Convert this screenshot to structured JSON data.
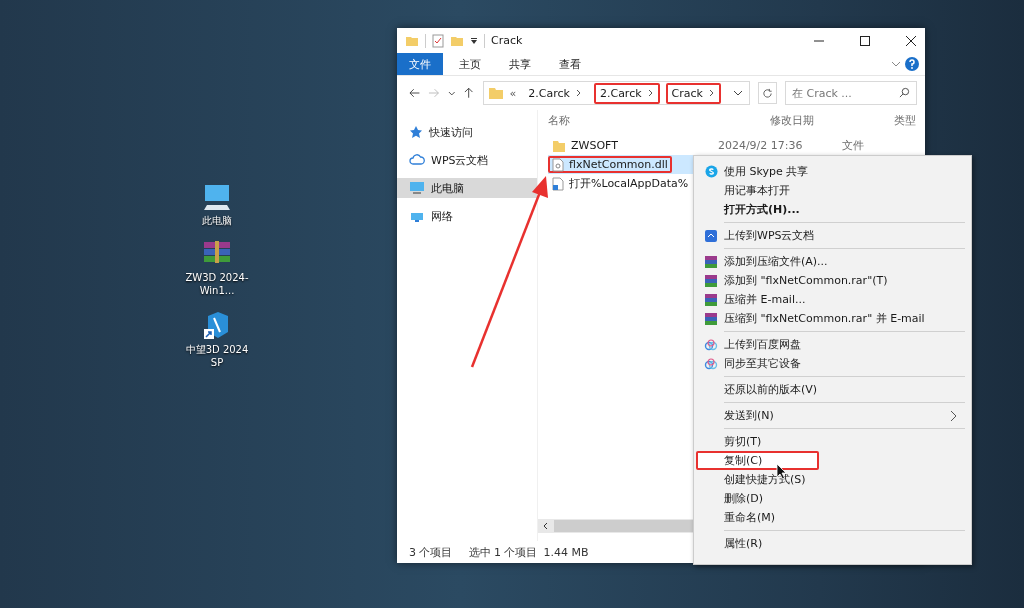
{
  "desktop_icons": [
    {
      "label": "此电脑",
      "kind": "computer"
    },
    {
      "label": "ZW3D 2024-Win1...",
      "kind": "archive"
    },
    {
      "label": "中望3D 2024 SP",
      "kind": "app"
    }
  ],
  "explorer": {
    "title": "Crack",
    "ribbon_tabs": [
      {
        "label": "文件",
        "selected": true
      },
      {
        "label": "主页",
        "selected": false
      },
      {
        "label": "共享",
        "selected": false
      },
      {
        "label": "查看",
        "selected": false
      }
    ],
    "address": {
      "overflow": "«",
      "crumbs": [
        {
          "label": "2.Carck",
          "highlighted": false
        },
        {
          "label": "2.Carck",
          "highlighted": true
        },
        {
          "label": "Crack",
          "highlighted": true
        }
      ]
    },
    "search": {
      "placeholder": "在 Crack ..."
    },
    "nav": [
      {
        "label": "快速访问",
        "kind": "star",
        "selected": false
      },
      {
        "label": "WPS云文档",
        "kind": "cloud",
        "selected": false
      },
      {
        "label": "此电脑",
        "kind": "computer",
        "selected": true
      },
      {
        "label": "网络",
        "kind": "network",
        "selected": false
      }
    ],
    "columns": [
      "名称",
      "修改日期",
      "类型"
    ],
    "rows": [
      {
        "name": "ZWSOFT",
        "date": "2024/9/2 17:36",
        "type": "文件",
        "kind": "folder",
        "selected": false,
        "highlighted": false
      },
      {
        "name": "flxNetCommon.dll",
        "kind": "file",
        "selected": true,
        "highlighted": true
      },
      {
        "name": "打开%LocalAppData%",
        "kind": "shortcut",
        "selected": false,
        "highlighted": false
      }
    ],
    "status": [
      "3 个项目",
      "选中 1 个项目",
      "1.44 MB"
    ]
  },
  "context_menu": {
    "groups": [
      [
        {
          "label": "使用 Skype 共享",
          "kind": "skype",
          "bold": false,
          "selected": false,
          "highlighted": false,
          "submenu": false
        },
        {
          "label": "用记事本打开",
          "bold": false,
          "selected": false,
          "highlighted": false,
          "submenu": false
        },
        {
          "label": "打开方式(H)...",
          "bold": true,
          "selected": false,
          "highlighted": false,
          "submenu": false
        }
      ],
      [
        {
          "label": "上传到WPS云文档",
          "kind": "wps",
          "bold": false,
          "selected": false,
          "highlighted": false,
          "submenu": false
        }
      ],
      [
        {
          "label": "添加到压缩文件(A)...",
          "kind": "rar",
          "bold": false,
          "selected": false,
          "highlighted": false,
          "submenu": false
        },
        {
          "label": "添加到 \"flxNetCommon.rar\"(T)",
          "kind": "rar",
          "bold": false,
          "selected": false,
          "highlighted": false,
          "submenu": false
        },
        {
          "label": "压缩并 E-mail...",
          "kind": "rar",
          "bold": false,
          "selected": false,
          "highlighted": false,
          "submenu": false
        },
        {
          "label": "压缩到 \"flxNetCommon.rar\" 并 E-mail",
          "kind": "rar",
          "bold": false,
          "selected": false,
          "highlighted": false,
          "submenu": false
        }
      ],
      [
        {
          "label": "上传到百度网盘",
          "kind": "baidu",
          "bold": false,
          "selected": false,
          "highlighted": false,
          "submenu": false
        },
        {
          "label": "同步至其它设备",
          "kind": "baidu",
          "bold": false,
          "selected": false,
          "highlighted": false,
          "submenu": false
        }
      ],
      [
        {
          "label": "还原以前的版本(V)",
          "bold": false,
          "selected": false,
          "highlighted": false,
          "submenu": false
        }
      ],
      [
        {
          "label": "发送到(N)",
          "bold": false,
          "selected": false,
          "highlighted": false,
          "submenu": true
        }
      ],
      [
        {
          "label": "剪切(T)",
          "bold": false,
          "selected": false,
          "highlighted": false,
          "submenu": false
        },
        {
          "label": "复制(C)",
          "bold": false,
          "selected": true,
          "highlighted": true,
          "submenu": false
        },
        {
          "label": "创建快捷方式(S)",
          "bold": false,
          "selected": false,
          "highlighted": false,
          "submenu": false
        },
        {
          "label": "删除(D)",
          "bold": false,
          "selected": false,
          "highlighted": false,
          "submenu": false
        },
        {
          "label": "重命名(M)",
          "bold": false,
          "selected": false,
          "highlighted": false,
          "submenu": false
        }
      ],
      [
        {
          "label": "属性(R)",
          "bold": false,
          "selected": false,
          "highlighted": false,
          "submenu": false
        }
      ]
    ]
  }
}
